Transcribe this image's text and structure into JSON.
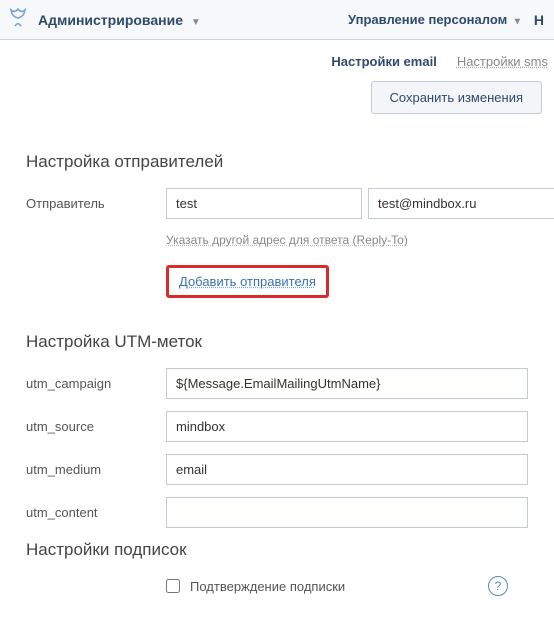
{
  "topbar": {
    "admin_label": "Администрирование",
    "right_link": "Управление персоналом",
    "right_cut": "Н"
  },
  "tabs": {
    "active": "Настройки email",
    "inactive": "Настройки sms"
  },
  "save_button": "Сохранить изменения",
  "section_senders": {
    "title": "Настройка отправителей",
    "sender_label": "Отправитель",
    "sender_name_value": "test",
    "sender_email_value": "test@mindbox.ru",
    "reply_to_link": "Указать другой адрес для ответа (Reply-To)",
    "add_sender_link": "Добавить отправителя"
  },
  "section_utm": {
    "title": "Настройка UTM-меток",
    "rows": [
      {
        "label": "utm_campaign",
        "value": "${Message.EmailMailingUtmName}"
      },
      {
        "label": "utm_source",
        "value": "mindbox"
      },
      {
        "label": "utm_medium",
        "value": "email"
      },
      {
        "label": "utm_content",
        "value": ""
      }
    ]
  },
  "section_sub": {
    "title": "Настройки подписок",
    "checkbox_label": "Подтверждение подписки",
    "help": "?"
  }
}
